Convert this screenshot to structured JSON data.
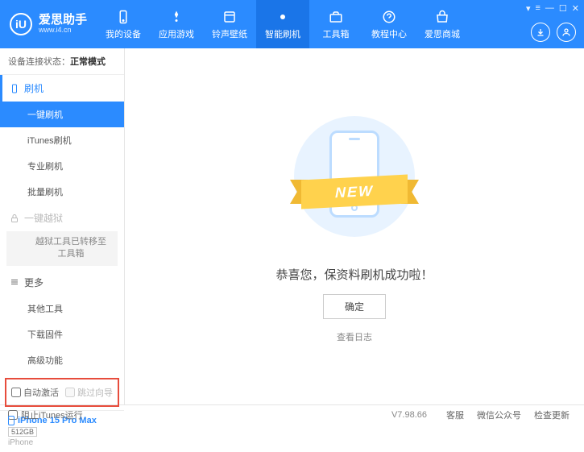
{
  "header": {
    "logo_text": "iU",
    "app_title": "爱思助手",
    "app_sub": "www.i4.cn",
    "nav": [
      {
        "label": "我的设备"
      },
      {
        "label": "应用游戏"
      },
      {
        "label": "铃声壁纸"
      },
      {
        "label": "智能刷机"
      },
      {
        "label": "工具箱"
      },
      {
        "label": "教程中心"
      },
      {
        "label": "爱思商城"
      }
    ]
  },
  "sidebar": {
    "conn_label": "设备连接状态：",
    "conn_mode": "正常模式",
    "sec_flash": "刷机",
    "items_flash": [
      "一键刷机",
      "iTunes刷机",
      "专业刷机",
      "批量刷机"
    ],
    "sec_jail": "一键越狱",
    "jail_note": "越狱工具已转移至工具箱",
    "sec_more": "更多",
    "items_more": [
      "其他工具",
      "下载固件",
      "高级功能"
    ],
    "chk_auto_activate": "自动激活",
    "chk_skip_guide": "跳过向导",
    "device_name": "iPhone 15 Pro Max",
    "device_cap": "512GB",
    "device_type": "iPhone"
  },
  "main": {
    "ribbon_text": "NEW",
    "message": "恭喜您，保资料刷机成功啦！",
    "ok_btn": "确定",
    "view_log": "查看日志"
  },
  "footer": {
    "block_itunes": "阻止iTunes运行",
    "version": "V7.98.66",
    "links": [
      "客服",
      "微信公众号",
      "检查更新"
    ]
  }
}
